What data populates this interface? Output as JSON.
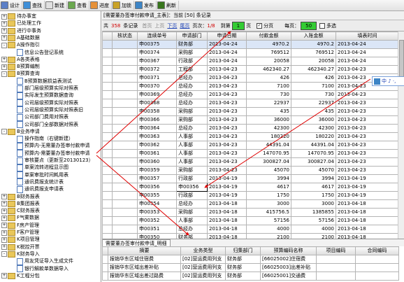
{
  "toolbar": {
    "items": [
      {
        "label": "设计",
        "icon": "design-icon",
        "color": "#5b7fc7"
      },
      {
        "label": "查找",
        "icon": "search-icon",
        "color": "#3f8fd8"
      },
      {
        "label": "新建",
        "icon": "new-icon",
        "color": "#e0e0e0"
      },
      {
        "label": "查看",
        "icon": "view-icon",
        "color": "#6aa84f"
      },
      {
        "label": "进度",
        "icon": "progress-icon",
        "color": "#e69138"
      },
      {
        "label": "加锁",
        "icon": "lock-icon",
        "color": "#c9a227"
      },
      {
        "label": "发布",
        "icon": "publish-icon",
        "color": "#3d85c6"
      },
      {
        "label": "刷新",
        "icon": "refresh-icon",
        "color": "#38761d"
      }
    ]
  },
  "tree": [
    {
      "label": "待办事宜",
      "type": "folder",
      "exp": "+"
    },
    {
      "label": "已处理工作",
      "type": "folder",
      "exp": "+"
    },
    {
      "label": "进行中事务",
      "type": "folder",
      "exp": "+"
    },
    {
      "label": "A基础数据",
      "type": "folder",
      "exp": "+"
    },
    {
      "label": "A操作指引",
      "type": "folder",
      "exp": "-"
    },
    {
      "label": "信息公告登记系统",
      "type": "doc"
    },
    {
      "label": "A各类表格",
      "type": "folder",
      "exp": "+"
    },
    {
      "label": "B预算编制",
      "type": "folder",
      "exp": "+"
    },
    {
      "label": "B预算查询",
      "type": "folder",
      "exp": "-"
    },
    {
      "label": "B预算数据损益表测试",
      "type": "doc"
    },
    {
      "label": "部门层级预算实际对照表",
      "type": "doc"
    },
    {
      "label": "实际发生预算数据查询",
      "type": "doc"
    },
    {
      "label": "公司层级预算实际对照表",
      "type": "doc"
    },
    {
      "label": "公司层级预算实际对照表旧",
      "type": "doc"
    },
    {
      "label": "公司部门费用对照表",
      "type": "doc"
    },
    {
      "label": "公司部门全部数据对照表",
      "type": "doc"
    },
    {
      "label": "B业务申请",
      "type": "folder",
      "exp": "-"
    },
    {
      "label": "操作指南（右键新建）",
      "type": "doc"
    },
    {
      "label": "预算内-无需董办签审付款申请",
      "type": "doc"
    },
    {
      "label": "预算内-需要董办签审付款申请",
      "type": "doc"
    },
    {
      "label": "审核要点（更新至20130123）",
      "type": "doc"
    },
    {
      "label": "单案流转进程显示图",
      "type": "doc"
    },
    {
      "label": "单案审批时间耗用表",
      "type": "doc"
    },
    {
      "label": "通讯费报支统计表",
      "type": "doc"
    },
    {
      "label": "通讯费报支申请表",
      "type": "doc"
    },
    {
      "label": "B财务报表",
      "type": "folder",
      "exp": "+"
    },
    {
      "label": "B集团报表",
      "type": "folder",
      "exp": "+"
    },
    {
      "label": "C财务报表",
      "type": "folder",
      "exp": "+"
    },
    {
      "label": "F气雾数据",
      "type": "folder",
      "exp": "+"
    },
    {
      "label": "F房产管理",
      "type": "folder",
      "exp": "+"
    },
    {
      "label": "F客户管理",
      "type": "folder",
      "exp": "+"
    },
    {
      "label": "K项目管理",
      "type": "folder",
      "exp": "+"
    },
    {
      "label": "K税控开票",
      "type": "folder",
      "exp": "+"
    },
    {
      "label": "K财务导入",
      "type": "folder",
      "exp": "-"
    },
    {
      "label": "用友凭证导入生成文件",
      "type": "doc"
    },
    {
      "label": "银行解款单数据导入",
      "type": "doc"
    },
    {
      "label": "K工程分包",
      "type": "folder",
      "exp": "+"
    }
  ],
  "title": "[需要董办签审付款申请_主表]：当前 [50] 条记录",
  "nav": {
    "total_label": "共",
    "total": "358",
    "records_label": "条记录",
    "first": "首页",
    "prev": "上页",
    "next": "下页",
    "last": "尾页",
    "pages_label": "页次：",
    "pages": "1/8",
    "goto_label": "到第",
    "goto_value": "1",
    "goto_unit": "页",
    "paging_label": "分页",
    "pagesize_label": "每页：",
    "pagesize": "50",
    "multi_label": "多选"
  },
  "grid": {
    "headers": [
      "",
      "核状态",
      "连续单号",
      "申请部门",
      "申请日期",
      "付款金额",
      "入账金额",
      "填表时间"
    ],
    "rows": [
      [
        "",
        "",
        "申00375",
        "财务部",
        "2013-04-24",
        "4970.2",
        "4970.2",
        "2013-04-24"
      ],
      [
        "",
        "",
        "申00374",
        "采购部",
        "2013-04-24",
        "769512",
        "769512",
        "2013-04-24"
      ],
      [
        "",
        "",
        "申00367",
        "行政部",
        "2013-04-24",
        "20058",
        "20058",
        "2013-04-24"
      ],
      [
        "",
        "",
        "申00372",
        "工程部",
        "2013-04-23",
        "462340.27",
        "462340.27",
        "2013-04-23"
      ],
      [
        "",
        "",
        "申00371",
        "总经办",
        "2013-04-23",
        "426",
        "426",
        "2013-04-23"
      ],
      [
        "",
        "",
        "申00370",
        "总经办",
        "2013-04-23",
        "7100",
        "7100",
        "2013-04-23"
      ],
      [
        "",
        "",
        "申00369",
        "总经办",
        "2013-04-23",
        "730",
        "730",
        "2013-04-23"
      ],
      [
        "",
        "",
        "申00368",
        "总经办",
        "2013-04-23",
        "22937",
        "22937",
        "2013-04-23"
      ],
      [
        "",
        "",
        "申00358",
        "采购部",
        "2013-04-23",
        "435",
        "435",
        "2013-04-23"
      ],
      [
        "",
        "",
        "申00366",
        "采购部",
        "2013-04-23",
        "36000",
        "36000",
        "2013-04-23"
      ],
      [
        "",
        "",
        "申00364",
        "总经办",
        "2013-04-23",
        "42300",
        "42300",
        "2013-04-23"
      ],
      [
        "",
        "",
        "申00363",
        "人事部",
        "2013-04-23",
        "180220",
        "180220",
        "2013-04-23"
      ],
      [
        "",
        "",
        "申00362",
        "人事部",
        "2013-04-23",
        "44391.04",
        "44391.04",
        "2013-04-23"
      ],
      [
        "",
        "",
        "申00361",
        "人事部",
        "2013-04-23",
        "147070.95",
        "147070.95",
        "2013-04-23"
      ],
      [
        "",
        "",
        "申00360",
        "人事部",
        "2013-04-23",
        "300827.04",
        "300827.04",
        "2013-04-23"
      ],
      [
        "",
        "",
        "申00359",
        "采购部",
        "2013-04-23",
        "45070",
        "45070",
        "2013-04-23"
      ],
      [
        "",
        "",
        "申00357",
        "行政部",
        "2013-04-19",
        "3994",
        "3994",
        "2013-04-19"
      ],
      [
        "",
        "",
        "申00356",
        "申00356",
        "2013-04-19",
        "4617",
        "4617",
        "2013-04-19"
      ],
      [
        "",
        "",
        "申00355",
        "行政部",
        "2013-04-19",
        "1750",
        "1750",
        "2013-04-19"
      ],
      [
        "",
        "",
        "申00354",
        "总经办",
        "2013-04-18",
        "3000",
        "3000",
        "2013-04-18"
      ],
      [
        "",
        "",
        "申00353",
        "采购部",
        "2013-04-18",
        "415756.5",
        "1385855",
        "2013-04-18"
      ],
      [
        "",
        "",
        "申00352",
        "人事部",
        "2013-04-18",
        "57156",
        "57156",
        "2013-04-18"
      ],
      [
        "",
        "",
        "申00351",
        "总经办",
        "2013-04-18",
        "4000",
        "4000",
        "2013-04-18"
      ],
      [
        "",
        "",
        "申00350",
        "财务部",
        "2013-04-18",
        "2100",
        "2100",
        "2013-04-18"
      ]
    ]
  },
  "ime": {
    "text": "中 ♪ ·,"
  },
  "subtab": {
    "label": "需要董办签审付款申请_明细"
  },
  "subgrid": {
    "headers": [
      "",
      "摘要",
      "业务类型",
      "归集部门",
      "预算编码名称",
      "项目编码",
      "合同编码"
    ],
    "rows": [
      [
        "",
        "报销华东区域住宿费",
        "[02]营运费用列支",
        "财务部",
        "[66025002]住宿费",
        "",
        ""
      ],
      [
        "",
        "报销华东区域出差补贴",
        "[02]营运费用列支",
        "财务部",
        "[66025003]出差补贴",
        "",
        ""
      ],
      [
        "",
        "报销华东区域出差过路费",
        "[02]营运费用列支",
        "财务部",
        "[66025001]交通费",
        "",
        ""
      ]
    ]
  }
}
